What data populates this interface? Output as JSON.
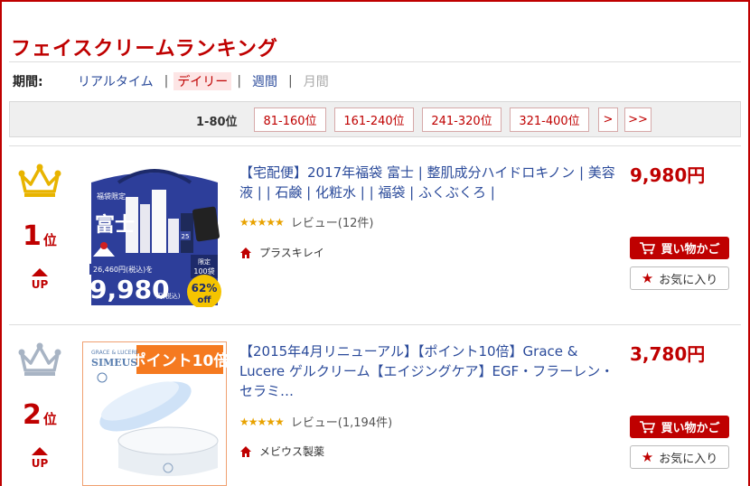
{
  "page": {
    "title": "フェイスクリームランキング"
  },
  "period": {
    "label": "期間:",
    "options": [
      "リアルタイム",
      "デイリー",
      "週間",
      "月間"
    ],
    "separator": "|"
  },
  "pager": {
    "current": "1-80位",
    "pages": [
      "81-160位",
      "161-240位",
      "241-320位",
      "321-400位"
    ],
    "next": ">",
    "last": ">>"
  },
  "items": [
    {
      "rank": "1",
      "rank_unit": "位",
      "trend": "UP",
      "crown_color": "#e8b400",
      "name": "【宅配便】2017年福袋 富士 | 整肌成分ハイドロキノン | 美容液 | | 石鹸 | 化粧水 | | 福袋 | ふくぶくろ |",
      "stars": "★★★★★",
      "review": "レビュー(12件)",
      "shop": "プラスキレイ",
      "price": "9,980円",
      "cart_label": "買い物かご",
      "fav_label": "お気に入り",
      "thumb": {
        "brand": "富士",
        "tag": "福袋限定",
        "original": "26,460円(税込)を",
        "price": "9,980",
        "price_unit": "円(税込)",
        "bag_note_top": "限定",
        "bag_note_qty": "100袋",
        "discount": "62%",
        "discount_unit": "off",
        "bottle_no": "25"
      }
    },
    {
      "rank": "2",
      "rank_unit": "位",
      "trend": "UP",
      "crown_color": "#a8b4c4",
      "name": "【2015年4月リニューアル】【ポイント10倍】Grace & Lucere ゲルクリーム【エイジングケア】EGF・フラーレン・セラミ…",
      "stars": "★★★★★",
      "review": "レビュー(1,194件)",
      "shop": "メビウス製薬",
      "price": "3,780円",
      "cart_label": "買い物かご",
      "fav_label": "お気に入り",
      "thumb": {
        "brand_small": "GRACE & LUCERE",
        "brand": "SIMEUS",
        "banner": "ポイント10倍"
      }
    }
  ]
}
